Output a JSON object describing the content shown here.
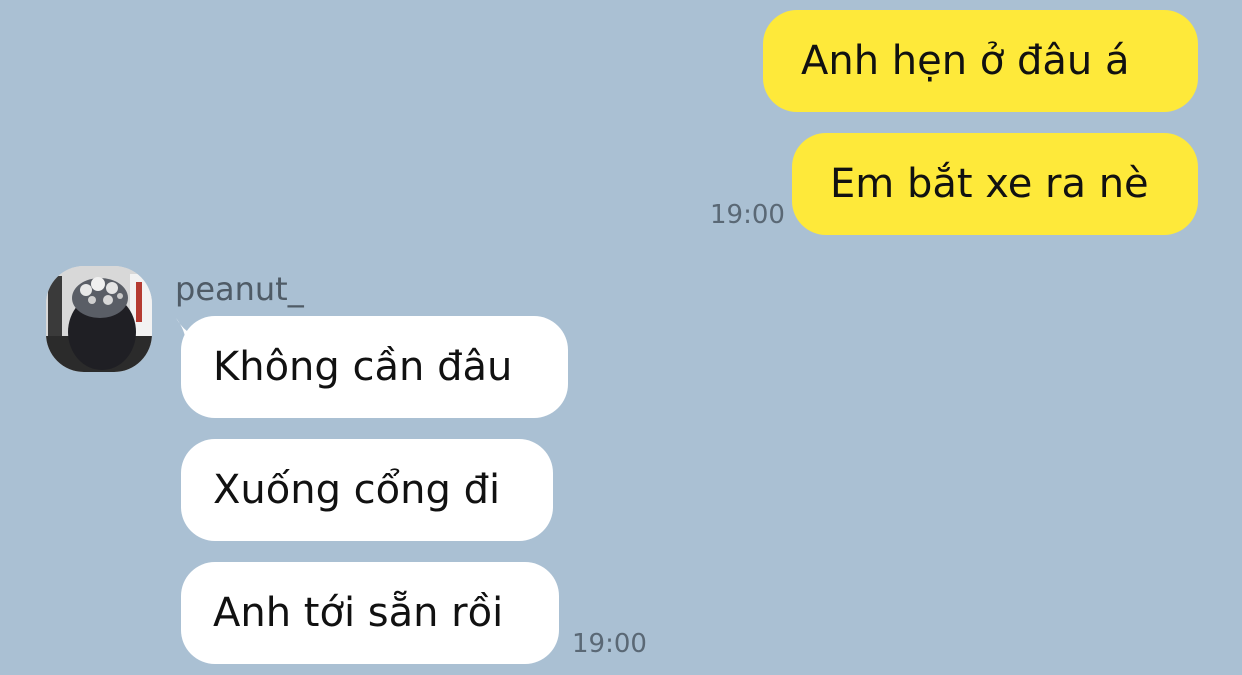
{
  "sent_messages": [
    {
      "text": "Anh hẹn ở đâu á"
    },
    {
      "text": "Em bắt xe ra nè"
    }
  ],
  "sent_time": "19:00",
  "contact": {
    "name": "peanut_",
    "avatar_icon": "profile-photo"
  },
  "received_messages": [
    {
      "text": "Không cần đâu"
    },
    {
      "text": "Xuống cổng đi"
    },
    {
      "text": "Anh tới sẵn rồi"
    }
  ],
  "received_time": "19:00",
  "colors": {
    "background": "#aac0d3",
    "sent_bubble": "#fee93a",
    "received_bubble": "#ffffff",
    "timestamp": "#5a6875"
  }
}
